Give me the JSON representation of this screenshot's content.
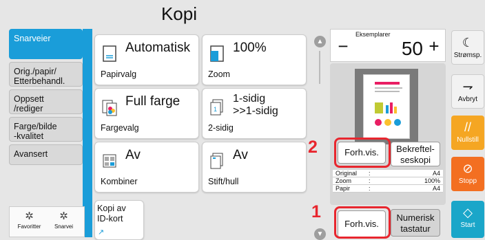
{
  "header": {
    "title": "Kopi"
  },
  "tabs": [
    {
      "label": "Snarveier",
      "active": true
    },
    {
      "label": "Orig./papir/\nEtterbehandl.",
      "active": false
    },
    {
      "label": "Oppsett\n/rediger",
      "active": false
    },
    {
      "label": "Farge/bilde\n-kvalitet",
      "active": false
    },
    {
      "label": "Avansert",
      "active": false
    }
  ],
  "bottom_buttons": {
    "favorites": "Favoritter",
    "shortcut": "Snarvei"
  },
  "tiles": {
    "paper": {
      "value": "Automatisk",
      "label": "Papirvalg"
    },
    "zoom": {
      "value": "100%",
      "label": "Zoom"
    },
    "color": {
      "value": "Full farge",
      "label": "Fargevalg"
    },
    "duplex": {
      "value": "1-sidig\n>>1-sidig",
      "label": "2-sidig"
    },
    "combine": {
      "value": "Av",
      "label": "Kombiner"
    },
    "staple": {
      "value": "Av",
      "label": "Stift/hull"
    },
    "idcard": {
      "value": "Kopi av\nID-kort"
    }
  },
  "copies": {
    "label": "Eksemplarer",
    "value": "50",
    "minus": "−",
    "plus": "+"
  },
  "preview": {
    "preview_button_top": "Forh.vis.",
    "confirm_button": "Bekreftel-\nseskopi",
    "info": [
      {
        "key": "Original",
        "value": "A4"
      },
      {
        "key": "Zoom",
        "value": "100%"
      },
      {
        "key": "Papir",
        "value": "A4"
      }
    ],
    "preview_button_bottom": "Forh.vis.",
    "numeric_button": "Numerisk\ntastatur"
  },
  "callouts": {
    "one": "1",
    "two": "2"
  },
  "right_buttons": {
    "power": "Strømsp.",
    "cancel": "Avbryt",
    "reset": "Nullstill",
    "stop": "Stopp",
    "start": "Start"
  },
  "colors": {
    "accent": "#1a9dd9",
    "reset": "#f5a623",
    "stop": "#f36f21",
    "start": "#1aa6c9",
    "callout": "#e8262e"
  }
}
